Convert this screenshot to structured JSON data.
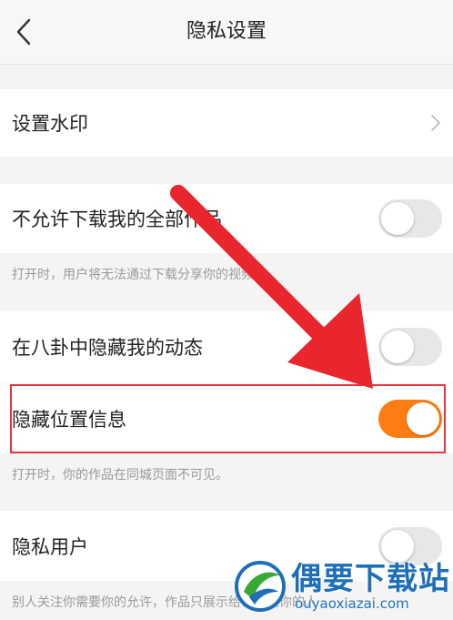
{
  "header": {
    "title": "隐私设置"
  },
  "rows": {
    "watermark": {
      "label": "设置水印"
    },
    "no_download": {
      "label": "不允许下载我的全部作品",
      "enabled": false,
      "note": "打开时，用户将无法通过下载分享你的视频。"
    },
    "hide_gossip": {
      "label": "在八卦中隐藏我的动态",
      "enabled": false
    },
    "hide_location": {
      "label": "隐藏位置信息",
      "enabled": true,
      "note": "打开时，你的作品在同城页面不可见。"
    },
    "private_user": {
      "label": "隐私用户",
      "enabled": false,
      "note": "别人关注你需要你的允许，作品只展示给已关注你的人"
    }
  },
  "watermark_overlay": {
    "brand": "偶要下载站",
    "url": "ouyaoxiazai.com"
  },
  "colors": {
    "accent": "#ff7d12",
    "highlight": "#e8343c",
    "arrow": "#e8262c",
    "brand": "#1e6fb8"
  },
  "icons": {
    "back": "chevron-left-icon",
    "row_arrow": "chevron-right-icon"
  }
}
